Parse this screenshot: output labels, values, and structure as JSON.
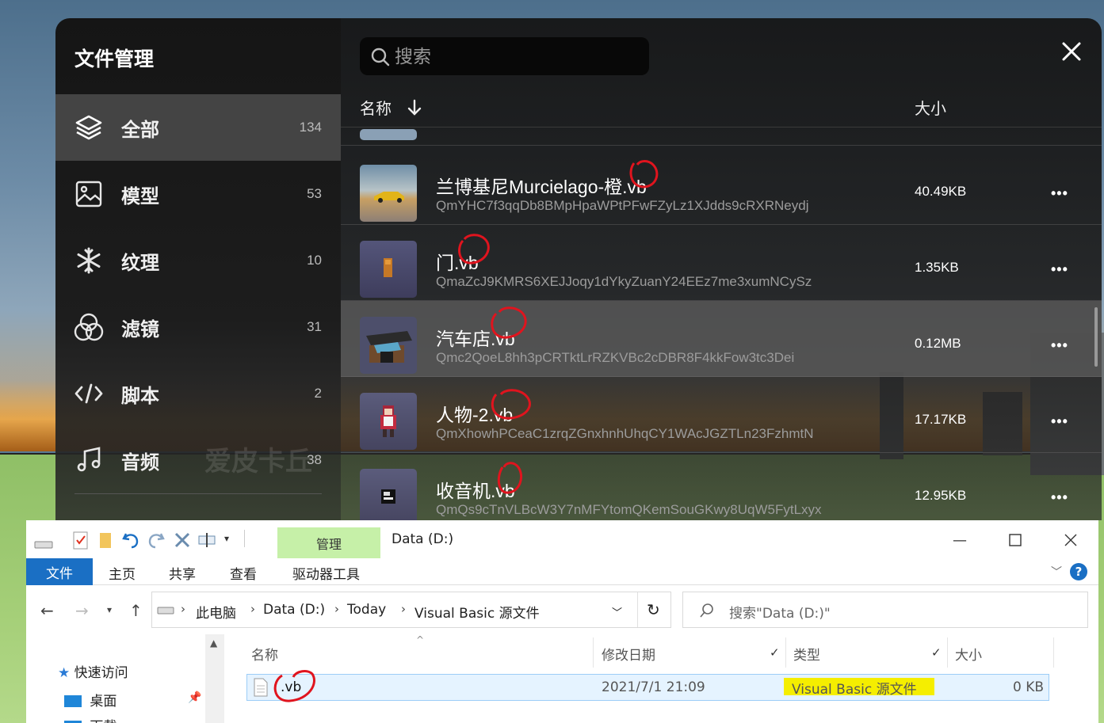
{
  "file_manager": {
    "title": "文件管理",
    "search_placeholder": "搜索",
    "columns": {
      "name": "名称",
      "size": "大小"
    },
    "categories": [
      {
        "label": "全部",
        "count": "134",
        "icon": "layers-icon"
      },
      {
        "label": "模型",
        "count": "53",
        "icon": "image-icon"
      },
      {
        "label": "纹理",
        "count": "10",
        "icon": "snowflake-icon"
      },
      {
        "label": "滤镜",
        "count": "31",
        "icon": "filter-circles-icon"
      },
      {
        "label": "脚本",
        "count": "2",
        "icon": "code-icon"
      },
      {
        "label": "音频",
        "count": "38",
        "icon": "music-note-icon"
      }
    ],
    "watermark": "爱皮卡丘",
    "files": [
      {
        "name": "兰博基尼Murcielago-橙.vb",
        "hash": "QmYHC7f3qqDb8BMpHpaWPtPFwFZyLz1XJdds9cRXRNeydj",
        "size": "40.49KB",
        "more": "•••"
      },
      {
        "name": "门.vb",
        "hash": "QmaZcJ9KMRS6XEJJoqy1dYkyZuanY24EEz7me3xumNCySz",
        "size": "1.35KB",
        "more": "•••"
      },
      {
        "name": "汽车店.vb",
        "hash": "Qmc2QoeL8hh3pCRTktLrRZKVBc2cDBR8F4kkFow3tc3Dei",
        "size": "0.12MB",
        "more": "•••"
      },
      {
        "name": "人物-2.vb",
        "hash": "QmXhowhPCeaC1zrqZGnxhnhUhqCY1WAcJGZTLn23FzhmtN",
        "size": "17.17KB",
        "more": "•••"
      },
      {
        "name": "收音机.vb",
        "hash": "QmQs9cTnVLBcW3Y7nMFYtomQKemSouGKwy8UqW5FytLxyx",
        "size": "12.95KB",
        "more": "•••"
      }
    ]
  },
  "explorer": {
    "title": "Data (D:)",
    "manage_tab": "管理",
    "ribbon_tabs": {
      "file": "文件",
      "home": "主页",
      "share": "共享",
      "view": "查看",
      "drive_tools": "驱动器工具"
    },
    "breadcrumbs": [
      "此电脑",
      "Data (D:)",
      "Today",
      "Visual Basic 源文件"
    ],
    "search_placeholder": "搜索\"Data (D:)\"",
    "tree": {
      "quick_access": "快速访问",
      "desktop": "桌面",
      "downloads": "下载"
    },
    "columns": {
      "name": "名称",
      "modified": "修改日期",
      "type": "类型",
      "size": "大小"
    },
    "file": {
      "name": ".vb",
      "modified": "2021/7/1 21:09",
      "type": "Visual Basic 源文件",
      "size": "0 KB"
    },
    "help": "?"
  },
  "colors": {
    "accent_blue": "#1a6fc4",
    "manage_tab_green": "#c6f0a8",
    "annotation_red": "#e0141e",
    "type_highlight": "#f5ee00"
  }
}
